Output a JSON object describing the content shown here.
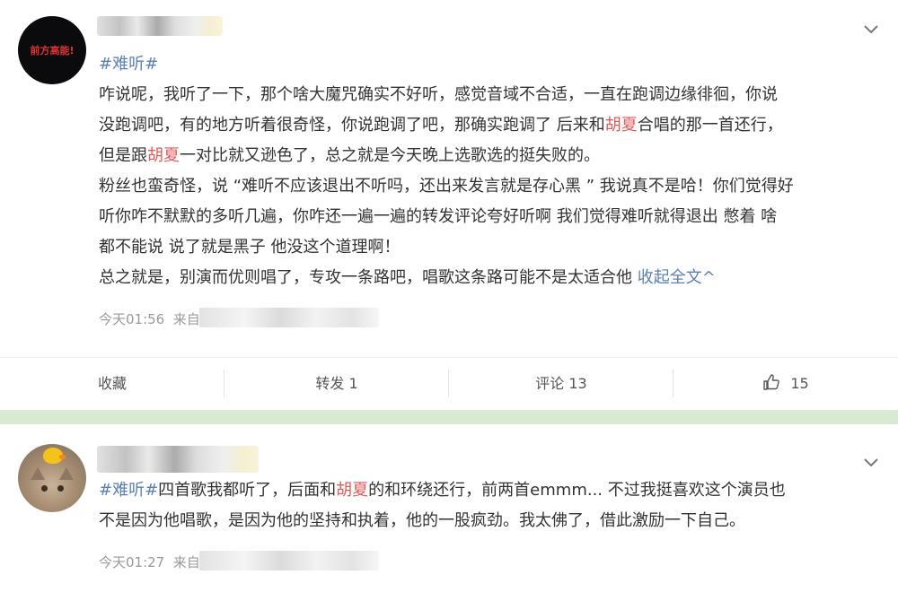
{
  "posts": [
    {
      "avatar_text": "前方高能!",
      "hashtag": "#难听#",
      "lines": [
        [
          {
            "t": "咋说呢，我听了一下，那个啥大魔咒确实不好听，感觉音域不合适，一直在跑调边缘徘徊，你说"
          }
        ],
        [
          {
            "t": "没跑调吧，有的地方听着很奇怪，你说跑调了吧，那确实跑调了 后来和"
          },
          {
            "t": "胡夏",
            "hl": true
          },
          {
            "t": "合唱的那一首还行，"
          }
        ],
        [
          {
            "t": "但是跟"
          },
          {
            "t": "胡夏",
            "hl": true
          },
          {
            "t": "一对比就又逊色了，总之就是今天晚上选歌选的挺失败的。"
          }
        ],
        [
          {
            "t": "粉丝也蛮奇怪，说 “难听不应该退出不听吗，还出来发言就是存心黑 ” 我说真不是哈！你们觉得好"
          }
        ],
        [
          {
            "t": "听你咋不默默的多听几遍，你咋还一遍一遍的转发评论夸好听啊 我们觉得难听就得退出 憋着 啥"
          }
        ],
        [
          {
            "t": "都不能说 说了就是黑子 他没这个道理啊！"
          }
        ],
        [
          {
            "t": "总之就是，别演而优则唱了，专攻一条路吧，唱歌这条路可能不是太适合他 "
          },
          {
            "t": "收起全文^",
            "link": true
          }
        ]
      ],
      "time": "今天01:56",
      "source_prefix": "来自",
      "actions": {
        "favorite": "收藏",
        "repost": "转发 1",
        "comment": "评论 13",
        "like_count": "15"
      },
      "icons": {
        "menu": "chevron-down-icon",
        "like": "thumbs-up-icon"
      }
    },
    {
      "hashtag": "#难听#",
      "lines": [
        [
          {
            "t": "四首歌我都听了，后面和"
          },
          {
            "t": "胡夏",
            "hl": true
          },
          {
            "t": "的和环绕还行，前两首emmm... 不过我挺喜欢这个演员也"
          }
        ],
        [
          {
            "t": "不是因为他唱歌，是因为他的坚持和执着，他的一股疯劲。我太佛了，借此激励一下自己。"
          }
        ]
      ],
      "time": "今天01:27",
      "source_prefix": "来自"
    }
  ],
  "colors": {
    "link": "#5b7fb7",
    "highlight": "#e05a5a",
    "separator": "#d7ebd3",
    "meta": "#9a9a9a"
  }
}
